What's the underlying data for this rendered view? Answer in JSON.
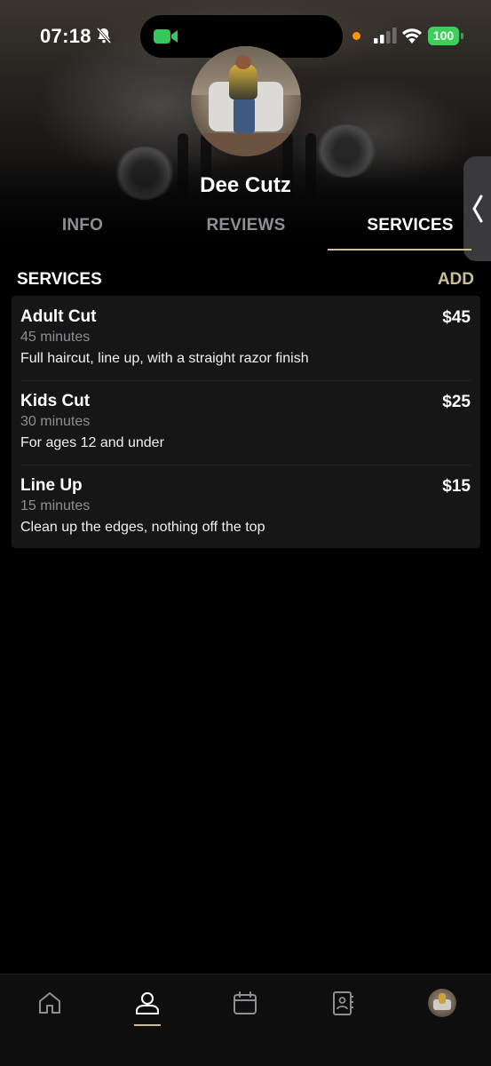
{
  "status_bar": {
    "time": "07:18",
    "battery": "100",
    "icons": [
      "bell-slash-icon",
      "facetime-camera-icon",
      "orange-dot-indicator",
      "cellular-signal-icon",
      "wifi-icon",
      "battery-icon"
    ]
  },
  "profile": {
    "name": "Dee Cutz",
    "avatar_icon": "profile-photo"
  },
  "tabs": [
    {
      "label": "INFO",
      "active": false
    },
    {
      "label": "REVIEWS",
      "active": false
    },
    {
      "label": "SERVICES",
      "active": true
    }
  ],
  "services_section": {
    "title": "SERVICES",
    "add_label": "ADD",
    "items": [
      {
        "name": "Adult Cut",
        "duration": "45 minutes",
        "description": "Full haircut, line up, with a straight razor finish",
        "price": "$45"
      },
      {
        "name": "Kids Cut",
        "duration": "30 minutes",
        "description": "For ages 12 and under",
        "price": "$25"
      },
      {
        "name": "Line Up",
        "duration": "15 minutes",
        "description": "Clean up the edges, nothing off the top",
        "price": "$15"
      }
    ]
  },
  "bottom_nav": {
    "items": [
      "home-icon",
      "profile-icon",
      "calendar-icon",
      "contacts-book-icon",
      "avatar"
    ],
    "active_index": 1
  },
  "colors": {
    "accent": "#cbbf9a",
    "background": "#000000",
    "card": "#161616",
    "muted_text": "#8e8e93",
    "battery": "#3ecf5a"
  }
}
